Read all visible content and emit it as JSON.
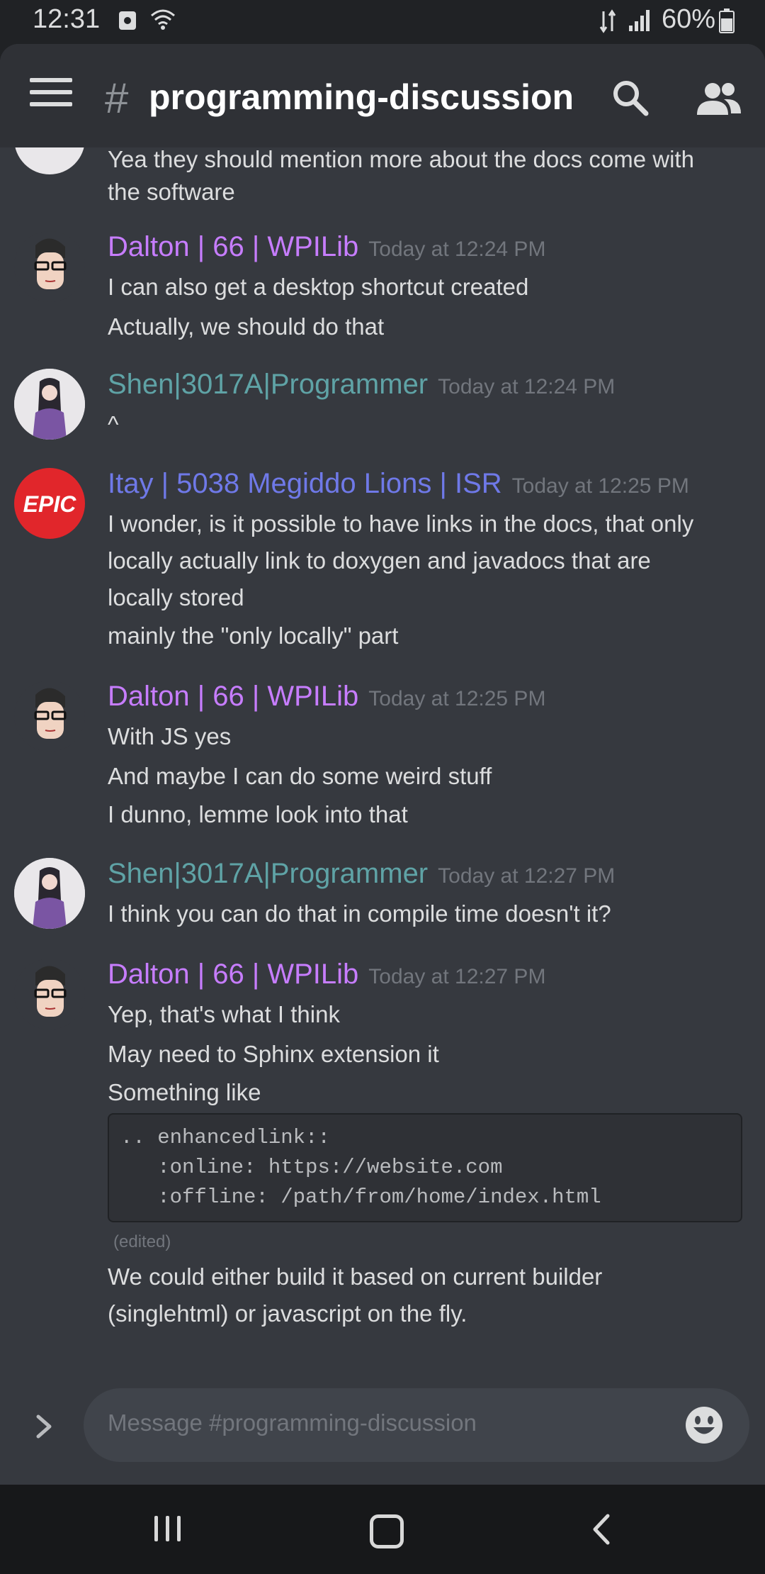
{
  "status_bar": {
    "time": "12:31",
    "battery": "60%"
  },
  "header": {
    "hash": "#",
    "title": "programming-discussion"
  },
  "messages": {
    "partial": {
      "lines": [
        "Yea they should mention more about the docs come with",
        "the software"
      ]
    },
    "group1": {
      "author": "Dalton | 66 | WPILib",
      "timestamp": "Today at 12:24 PM",
      "lines": [
        "I can also get a desktop shortcut created",
        "Actually, we should do that"
      ]
    },
    "group2": {
      "author": "Shen|3017A|Programmer",
      "timestamp": "Today at 12:24 PM",
      "lines": [
        "^"
      ]
    },
    "group3": {
      "author": "Itay | 5038 Megiddo Lions | ISR",
      "timestamp": "Today at 12:25 PM",
      "avatar_text": "EPIC",
      "lines": [
        "I wonder, is it possible to have links in the docs, that only",
        "locally actually link to doxygen and javadocs that are",
        "locally stored",
        "mainly the \"only locally\" part"
      ]
    },
    "group4": {
      "author": "Dalton | 66 | WPILib",
      "timestamp": "Today at 12:25 PM",
      "lines": [
        "With JS yes",
        "And maybe I can do some weird stuff",
        "I dunno, lemme look into that"
      ]
    },
    "group5": {
      "author": "Shen|3017A|Programmer",
      "timestamp": "Today at 12:27 PM",
      "lines": [
        "I think you can do that in compile time doesn't it?"
      ]
    },
    "group6": {
      "author": "Dalton | 66 | WPILib",
      "timestamp": "Today at 12:27 PM",
      "lines": [
        "Yep, that's what I think",
        "May need to Sphinx extension it",
        "Something like"
      ],
      "code": [
        ".. enhancedlink::",
        "   :online: https://website.com",
        "   :offline: /path/from/home/index.html"
      ],
      "edited": "(edited)",
      "after_lines": [
        "We could either build it based on current builder",
        "(singlehtml) or javascript on the fly."
      ]
    }
  },
  "composer": {
    "placeholder": "Message #programming-discussion"
  },
  "colors": {
    "background": "#36393f",
    "header": "#2f3136",
    "dalton_name": "#c77dff",
    "shen_name": "#5fa3a6",
    "itay_name": "#6f79e8",
    "epic_red": "#e1262b"
  },
  "icons": [
    "hamburger-menu-icon",
    "search-icon",
    "members-icon",
    "expand-icon",
    "emoji-icon",
    "wifi-icon",
    "signal-icon",
    "battery-icon"
  ]
}
